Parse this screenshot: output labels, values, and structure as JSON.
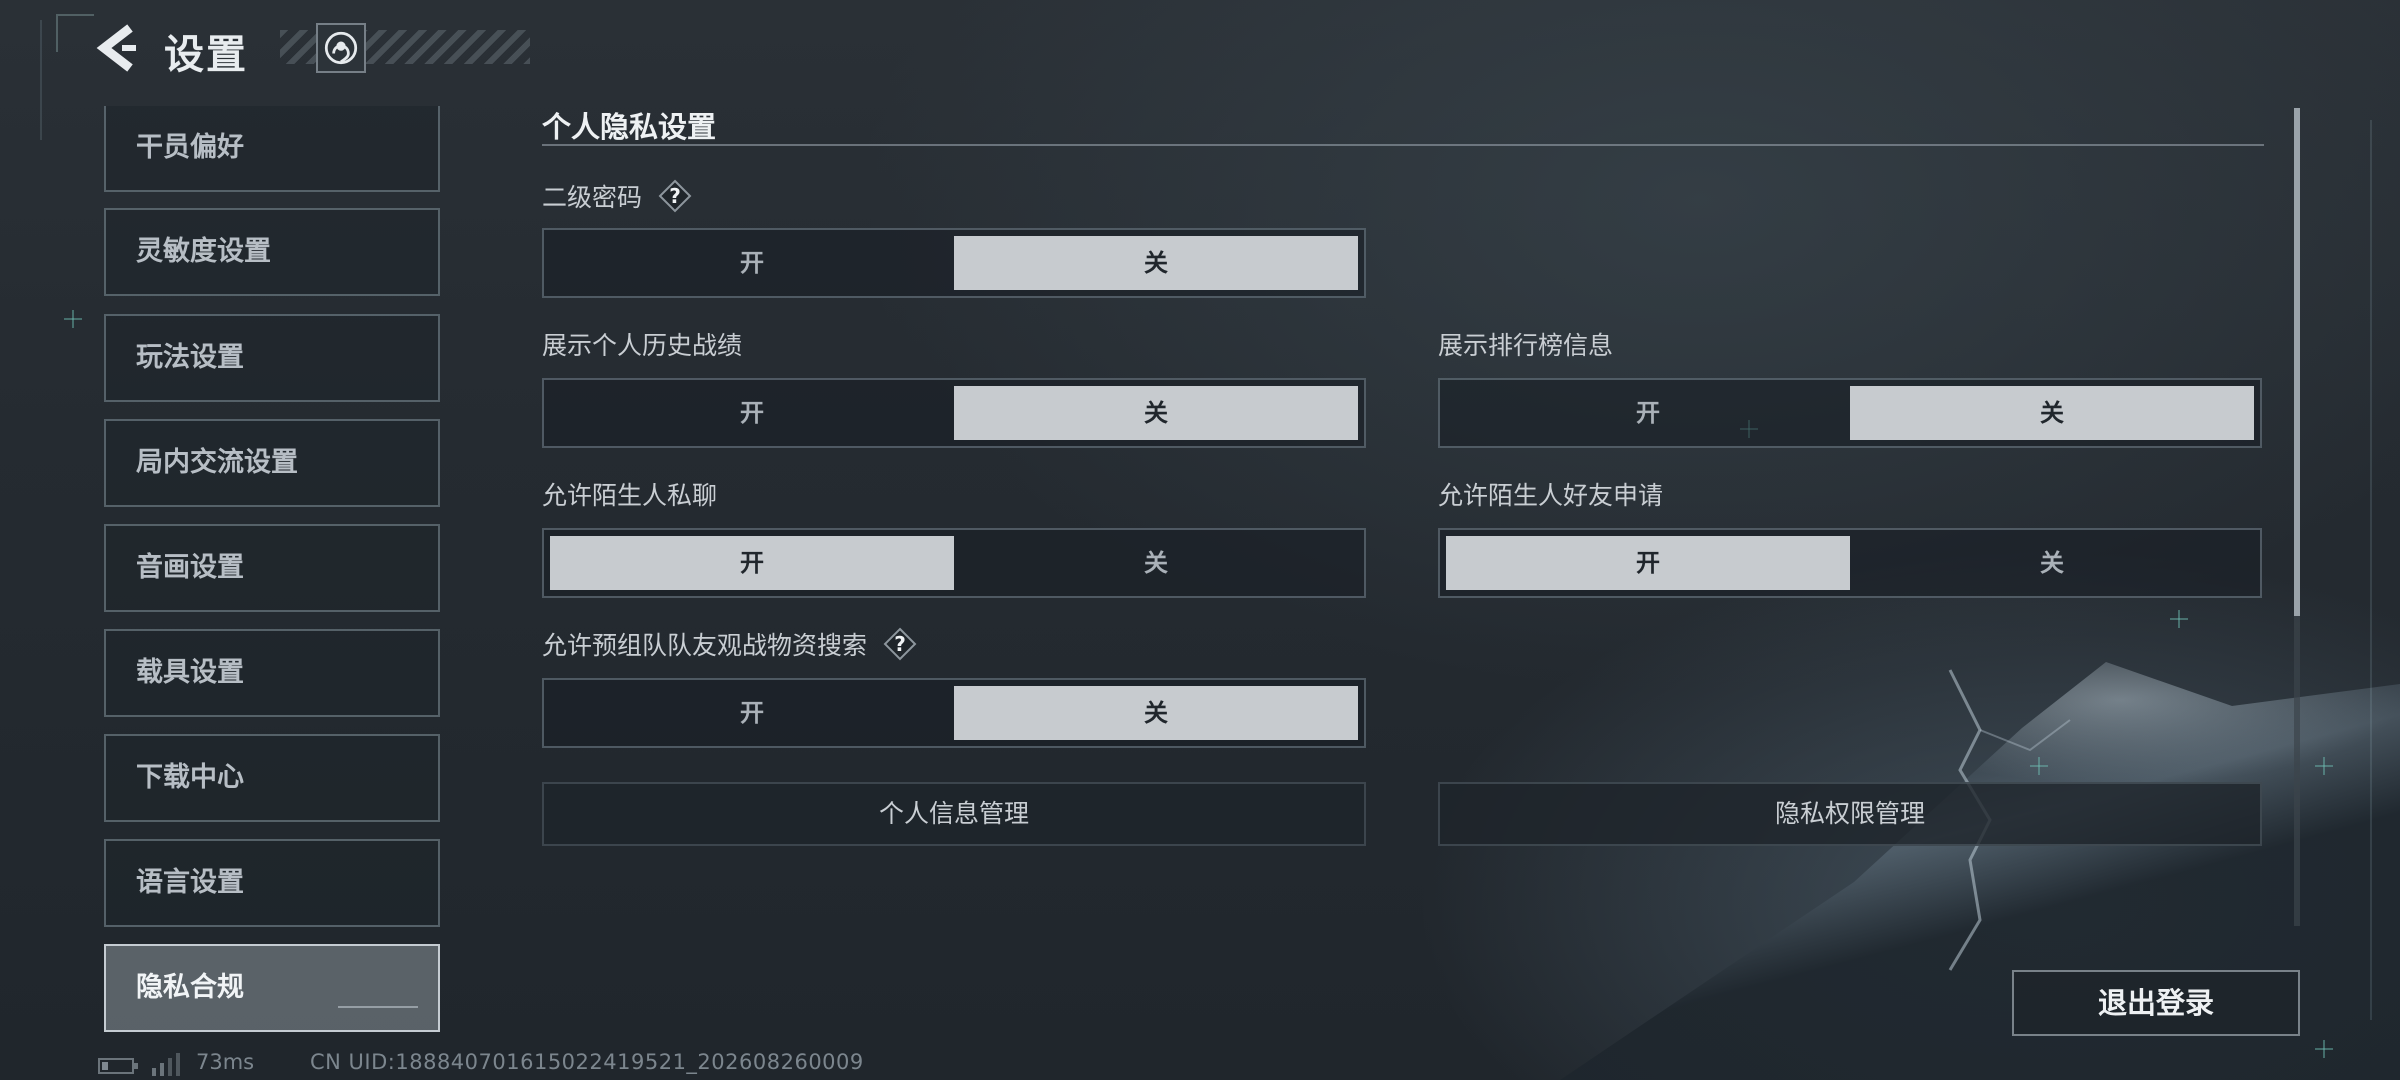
{
  "header": {
    "title": "设置"
  },
  "sidebar": {
    "items": [
      {
        "label": "干员偏好",
        "active": false
      },
      {
        "label": "灵敏度设置",
        "active": false
      },
      {
        "label": "玩法设置",
        "active": false
      },
      {
        "label": "局内交流设置",
        "active": false
      },
      {
        "label": "音画设置",
        "active": false
      },
      {
        "label": "载具设置",
        "active": false
      },
      {
        "label": "下载中心",
        "active": false
      },
      {
        "label": "语言设置",
        "active": false
      },
      {
        "label": "隐私合规",
        "active": true
      }
    ]
  },
  "main": {
    "section_title": "个人隐私设置",
    "settings": {
      "secondary_password": {
        "label": "二级密码",
        "on_label": "开",
        "off_label": "关",
        "selected": "关"
      },
      "show_history": {
        "label": "展示个人历史战绩",
        "on_label": "开",
        "off_label": "关",
        "selected": "关"
      },
      "show_leaderboard": {
        "label": "展示排行榜信息",
        "on_label": "开",
        "off_label": "关",
        "selected": "关"
      },
      "stranger_chat": {
        "label": "允许陌生人私聊",
        "on_label": "开",
        "off_label": "关",
        "selected": "开"
      },
      "stranger_friend_request": {
        "label": "允许陌生人好友申请",
        "on_label": "开",
        "off_label": "关",
        "selected": "开"
      },
      "team_watch_search": {
        "label": "允许预组队队友观战物资搜索",
        "on_label": "开",
        "off_label": "关",
        "selected": "关"
      }
    },
    "buttons": {
      "personal_info": "个人信息管理",
      "privacy_permissions": "隐私权限管理"
    }
  },
  "logout_label": "退出登录",
  "status": {
    "ping": "73ms",
    "uid": "CN UID:18884070161502241​9521_202608260009"
  },
  "colors": {
    "selected_option": "#c7cbcf",
    "background": "#252b31",
    "text": "#d8dde2"
  }
}
